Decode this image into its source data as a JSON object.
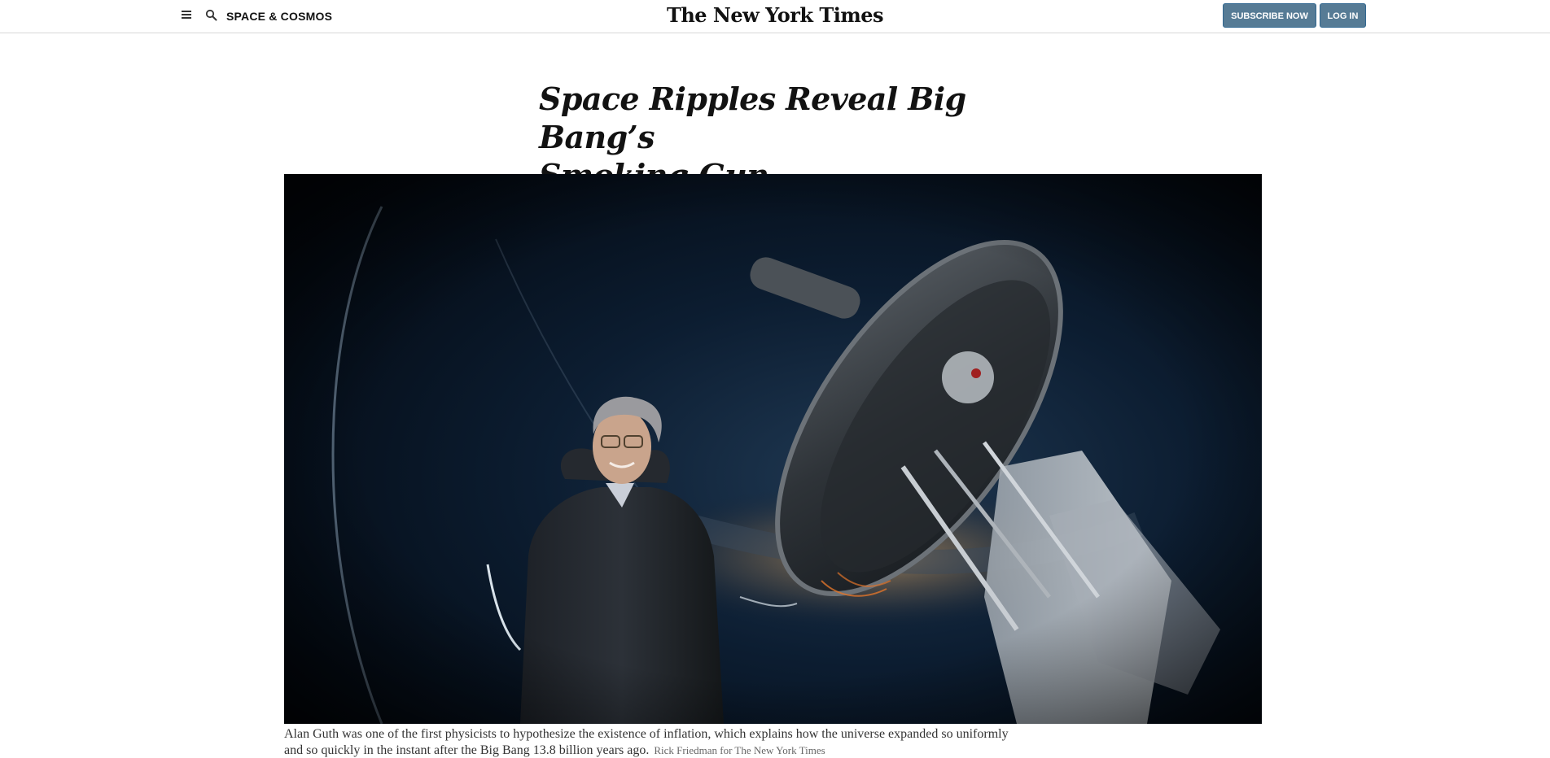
{
  "masthead": {
    "section": "SPACE & COSMOS",
    "logo": "The New York Times",
    "subscribe_label": "SUBSCRIBE NOW",
    "login_label": "LOG IN",
    "menu_icon": "hamburger-menu-icon",
    "search_icon": "search-icon"
  },
  "article": {
    "headline_line1": "Space Ripples Reveal Big Bang’s",
    "headline_line2": "Smoking Gun",
    "photo_alt": "Alan Guth standing beside a large telescope at night",
    "caption": "Alan Guth was one of the first physicists to hypothesize the existence of inflation, which explains how the universe expanded so uniformly and so quickly in the instant after the Big Bang 13.8 billion years ago.",
    "credit": "Rick Friedman for The New York Times"
  },
  "colors": {
    "button_bg": "#567b95",
    "text": "#121212",
    "caption": "#333333",
    "credit": "#666666"
  }
}
